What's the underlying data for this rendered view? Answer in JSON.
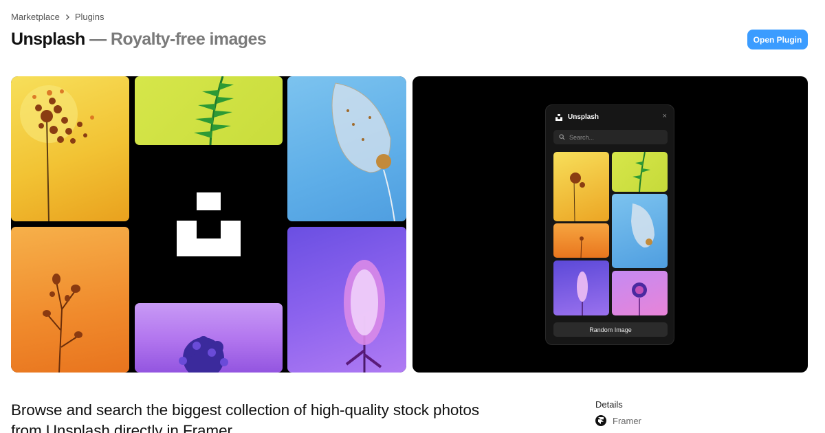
{
  "breadcrumb": {
    "root": "Marketplace",
    "current": "Plugins"
  },
  "header": {
    "name": "Unsplash",
    "dash": "—",
    "subtitle": "Royalty-free images",
    "open_button": "Open Plugin"
  },
  "colors": {
    "accent": "#3b9cff",
    "panel_bg": "#000000",
    "plugin_bg": "#161616"
  },
  "preview": {
    "plugin_title": "Unsplash",
    "search_placeholder": "Search...",
    "random_button": "Random Image",
    "close_glyph": "×"
  },
  "description": "Browse and search the biggest collection of high-quality stock photos from Unsplash directly in Framer.",
  "details": {
    "title": "Details",
    "developer": "Framer"
  }
}
